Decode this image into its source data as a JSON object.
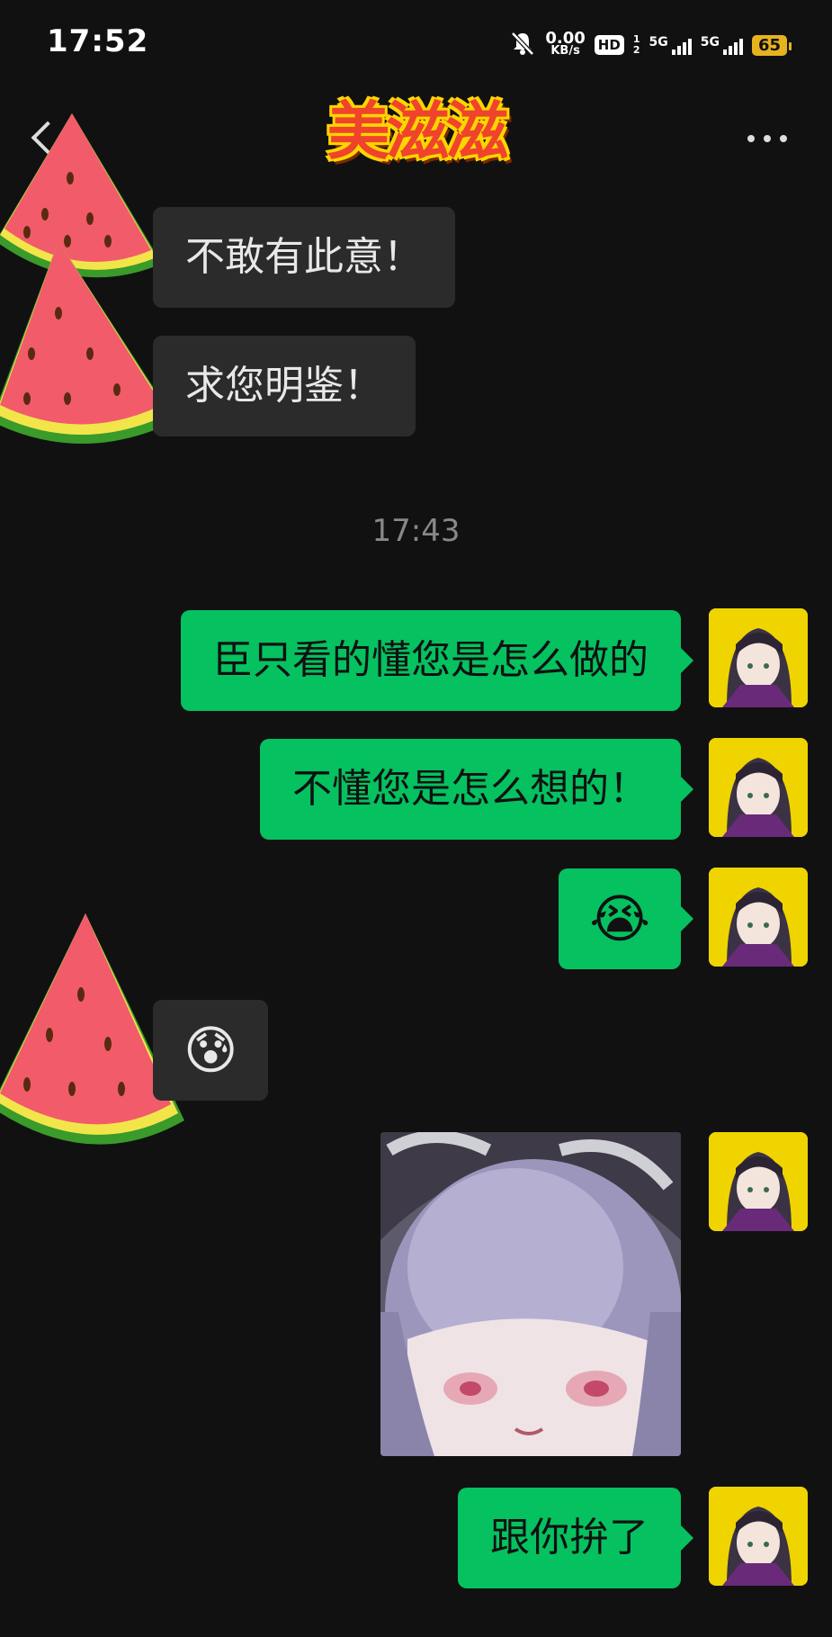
{
  "status_bar": {
    "time": "17:52",
    "net_speed": "0.00",
    "net_unit": "KB/s",
    "hd": "HD",
    "sim_label_1": "1",
    "sim_label_2": "2",
    "signal_1": "5G",
    "signal_2": "5G",
    "battery": "65"
  },
  "header": {
    "title": "美滋滋"
  },
  "messages": {
    "m1": "不敢有此意！",
    "m2": "求您明鉴！",
    "timestamp": "17:43",
    "m3": "臣只看的懂您是怎么做的",
    "m4": "不懂您是怎么想的！",
    "m5": "😭",
    "m6": "😰",
    "m8": "跟你拚了"
  },
  "colors": {
    "sent_bubble": "#05c160",
    "received_bubble": "#2b2b2b",
    "background": "#111111"
  }
}
